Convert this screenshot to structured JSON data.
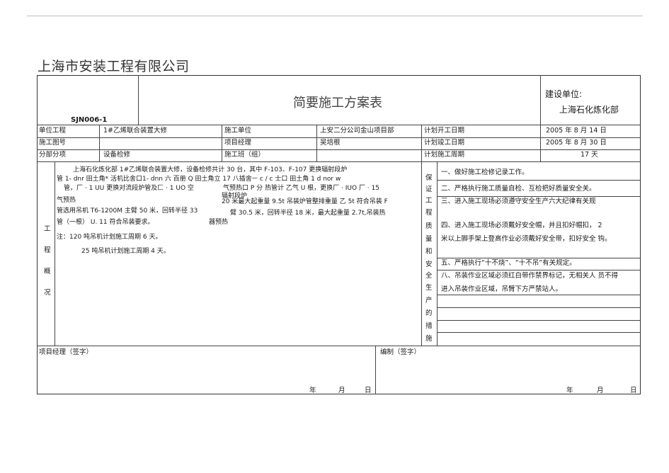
{
  "company": "上海市安装工程有限公司",
  "form": {
    "code": "SJN006-1",
    "title": "简要施工方案表",
    "builder_label": "建设单位:",
    "builder_value": "上海石化炼化部"
  },
  "info_rows": [
    {
      "l1": "单位工程",
      "v1": "1#乙烯联合装置大修",
      "l2": "施工单位",
      "v2": "上安二分公司金山项目部",
      "l3": "计划开工日期",
      "v3": "2005 年 8 月 14 日"
    },
    {
      "l1": "施工图号",
      "v1": "",
      "l2": "项目经理",
      "v2": "吴培根",
      "l3": "计划竣工日期",
      "v3": "2005 年 8 月 30 日"
    },
    {
      "l1": "分部分项",
      "v1": "设备检修",
      "l2": "施工班（组）",
      "v2": "",
      "l3": "计划施工周期",
      "v3": "17 天"
    }
  ],
  "overview": {
    "label": [
      "工",
      "程",
      "概",
      "况"
    ],
    "lines": [
      "上海石化炼化部 1#乙烯联合装置大修，设备检修共计        30 台，其中 F-103、F-107 更换辐射段炉",
      "管 1- dnr 田土角* 活机比舍口1- dnn 六 百册 Q 田土角立 17 八插舍ㅡ  c / c 士口 田土角 1 d nor w",
      "管，厂 · 1 UU 更换对流段炉管及匚 · 1 UO 空",
      "气预热",
      "器预热",
      "管选用吊机 T6-1200M 主臂 50 米，回转半径 33",
      "管（一根）   U. 11 符合吊装要求。",
      "注：120 吨吊机计划施工周期 6 天。",
      "25 吨吊机计划施工周期 4 天。"
    ],
    "overlay": [
      "气预热口 P 分 热管计   乙气 U 根，更换厂 · IUO 厂 · 15",
      "辐射段炉",
      "20 米最大起重量 9.5t 吊装炉管整排重量 乙 5t 符合吊装 F",
      "臂 30.5 米，回转半径 18 米，最大起重量 2.7t,吊装热"
    ]
  },
  "safety": {
    "label": [
      "保",
      "证",
      "工",
      "程",
      "质",
      "量",
      "和",
      "安",
      "全",
      "生",
      "产",
      "的",
      "措",
      "施"
    ],
    "items": [
      "一、做好施工检修记录工作。",
      "二、严格执行施工质量自检、互检把好质量安全关。",
      "三、进入施工现场必须遵守安全生产六大纪律有关规",
      "四、进入施工现场必须戴好安全帽，并且扣好帽扣，      2",
      "米以上脚手架上登高作业必须戴好安全带，扣好安全  钩。",
      "五、严格执行“十不烧”、“十不吊”有关规定。",
      "八、吊装作业区域必须红白带作禁界标记，无相关人  员不得",
      "进入吊装作业区域，吊臂下方严禁站人。"
    ]
  },
  "footer": {
    "left_label": "项目经理（签字）",
    "right_label": "编制（签字）",
    "year": "年",
    "month": "月",
    "day": "日"
  }
}
